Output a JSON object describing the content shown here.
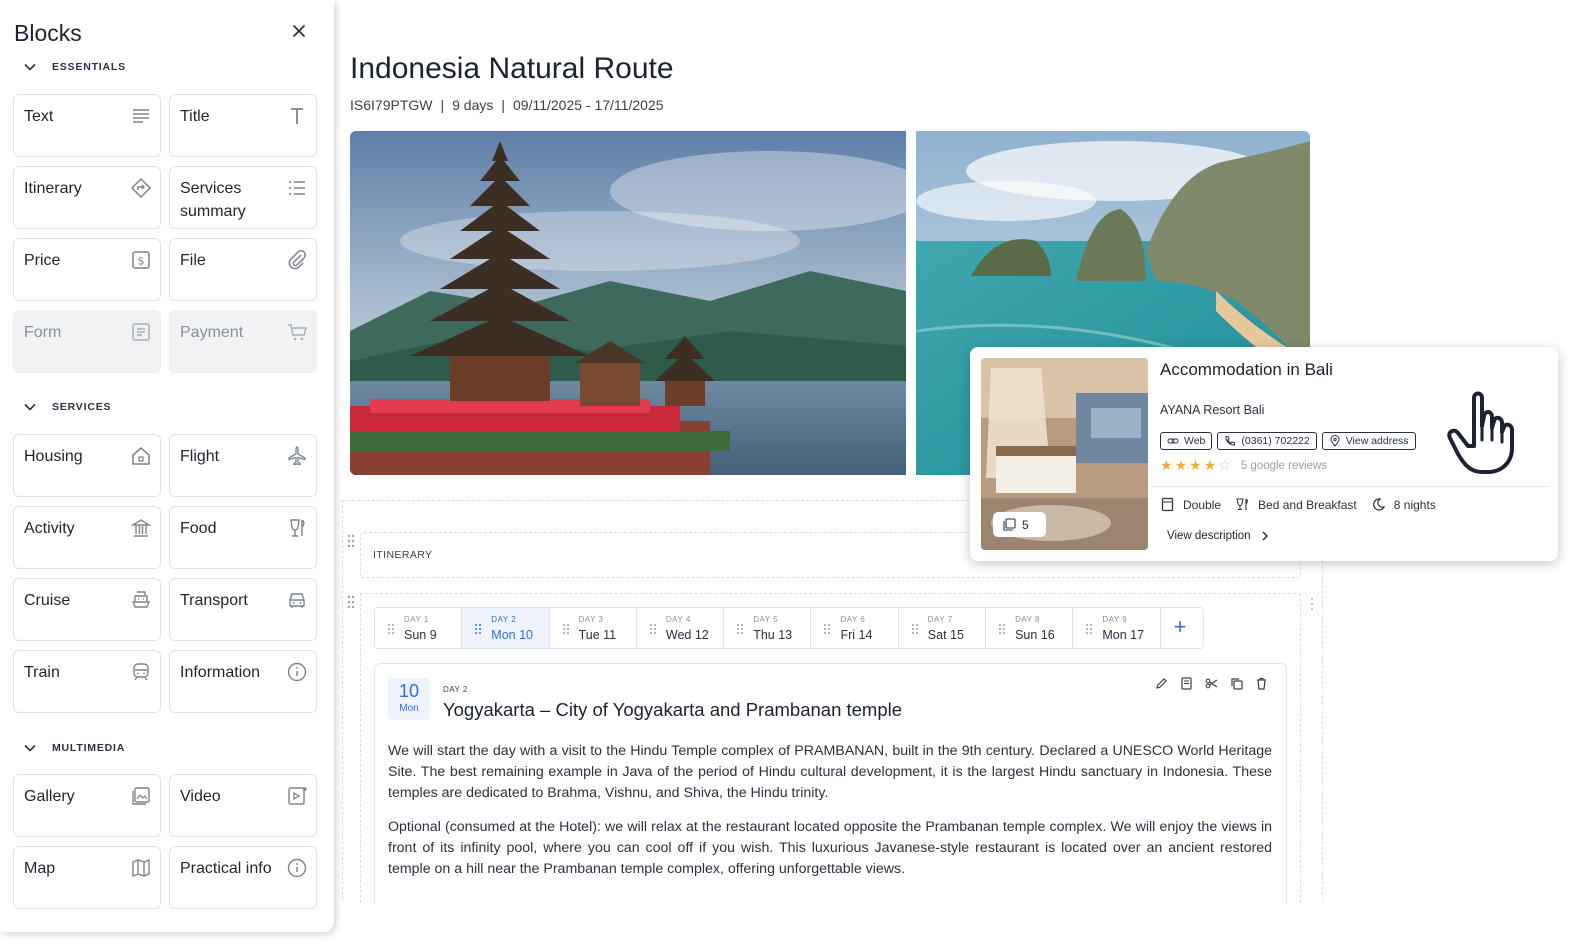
{
  "sidebar": {
    "title": "Blocks",
    "sections": {
      "essentials": "ESSENTIALS",
      "services": "SERVICES",
      "multimedia": "MULTIMEDIA"
    },
    "blocks": {
      "text": "Text",
      "title": "Title",
      "itinerary": "Itinerary",
      "services_summary": "Services summary",
      "price": "Price",
      "file": "File",
      "form": "Form",
      "payment": "Payment",
      "housing": "Housing",
      "flight": "Flight",
      "activity": "Activity",
      "food": "Food",
      "cruise": "Cruise",
      "transport": "Transport",
      "train": "Train",
      "information": "Information",
      "gallery": "Gallery",
      "video": "Video",
      "map": "Map",
      "practical_info": "Practical info"
    }
  },
  "trip": {
    "title": "Indonesia Natural Route",
    "code": "IS6I79PTGW",
    "sep": "|",
    "duration": "9 days",
    "dates": "09/11/2025 - 17/11/2025"
  },
  "itinerary": {
    "label": "ITINERARY",
    "days": [
      {
        "num": "DAY 1",
        "date": "Sun 9"
      },
      {
        "num": "DAY 2",
        "date": "Mon 10"
      },
      {
        "num": "DAY 3",
        "date": "Tue 11"
      },
      {
        "num": "DAY 4",
        "date": "Wed 12"
      },
      {
        "num": "DAY 5",
        "date": "Thu 13"
      },
      {
        "num": "DAY 6",
        "date": "Fri 14"
      },
      {
        "num": "DAY 7",
        "date": "Sat 15"
      },
      {
        "num": "DAY 8",
        "date": "Sun 16"
      },
      {
        "num": "DAY 9",
        "date": "Mon 17"
      }
    ],
    "add_label": "+",
    "selected": {
      "day_number": "10",
      "weekday": "Mon",
      "day_label": "DAY 2",
      "title": "Yogyakarta – City of Yogyakarta and Prambanan temple",
      "paragraph1": "We will start the day with a visit to the Hindu Temple complex of PRAMBANAN, built in the 9th century. Declared a UNESCO World Heritage Site. The best remaining example in Java of the period of Hindu cultural development, it is the largest Hindu sanctuary in Indonesia. These temples are dedicated to Brahma, Vishnu, and Shiva, the Hindu trinity.",
      "paragraph2": "Optional (consumed at the Hotel): we will relax at the restaurant located opposite the Prambanan temple complex. We will enjoy the views in front of its infinity pool, where you can cool off if you wish. This luxurious Javanese-style restaurant is located over an ancient restored temple on a hill near the Prambanan temple complex, offering unforgettable views."
    }
  },
  "accommodation": {
    "title": "Accommodation in Bali",
    "hotel": "AYANA Resort Bali",
    "photo_count": "5",
    "web": "Web",
    "phone": "(0361) 702222",
    "address": "View address",
    "rating": 4,
    "reviews": "5 google reviews",
    "room": "Double",
    "board": "Bed and Breakfast",
    "nights": "8 nights",
    "view_description": "View description"
  },
  "colors": {
    "accent": "#2f6fe0",
    "star": "#f2a93b"
  }
}
